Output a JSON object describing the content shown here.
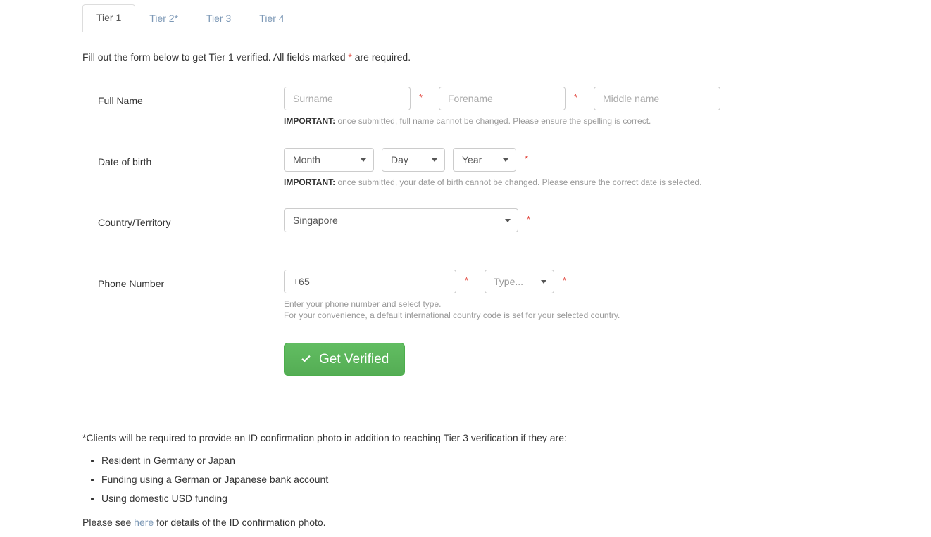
{
  "tabs": [
    {
      "label": "Tier 1",
      "active": true
    },
    {
      "label": "Tier 2*",
      "active": false
    },
    {
      "label": "Tier 3",
      "active": false
    },
    {
      "label": "Tier 4",
      "active": false
    }
  ],
  "intro": {
    "before_star": "Fill out the form below to get Tier 1 verified. All fields marked ",
    "star": "*",
    "after_star": " are required."
  },
  "form": {
    "full_name": {
      "label": "Full Name",
      "surname_placeholder": "Surname",
      "forename_placeholder": "Forename",
      "middle_placeholder": "Middle name",
      "surname_value": "",
      "forename_value": "",
      "middle_value": "",
      "star": "*",
      "help_strong": "IMPORTANT:",
      "help_text": " once submitted, full name cannot be changed. Please ensure the spelling is correct."
    },
    "dob": {
      "label": "Date of birth",
      "month": "Month",
      "day": "Day",
      "year": "Year",
      "star": "*",
      "help_strong": "IMPORTANT:",
      "help_text": " once submitted, your date of birth cannot be changed. Please ensure the correct date is selected."
    },
    "country": {
      "label": "Country/Territory",
      "value": "Singapore",
      "star": "*"
    },
    "phone": {
      "label": "Phone Number",
      "value": "+65",
      "type_placeholder": "Type...",
      "star": "*",
      "help_line1": "Enter your phone number and select type.",
      "help_line2": "For your convenience, a default international country code is set for your selected country."
    },
    "submit": {
      "label": "Get Verified",
      "icon": "check-icon",
      "color": "#5cb85c"
    }
  },
  "footer": {
    "intro": "*Clients will be required to provide an ID confirmation photo in addition to reaching Tier 3 verification if they are:",
    "bullets": [
      "Resident in Germany or Japan",
      "Funding using a German or Japanese bank account",
      "Using domestic USD funding"
    ],
    "note_before": "Please see ",
    "note_link": "here",
    "note_after": " for details of the ID confirmation photo."
  },
  "colors": {
    "required_star": "#e3453c",
    "link": "#7c98b6",
    "submit_green": "#5cb85c"
  }
}
